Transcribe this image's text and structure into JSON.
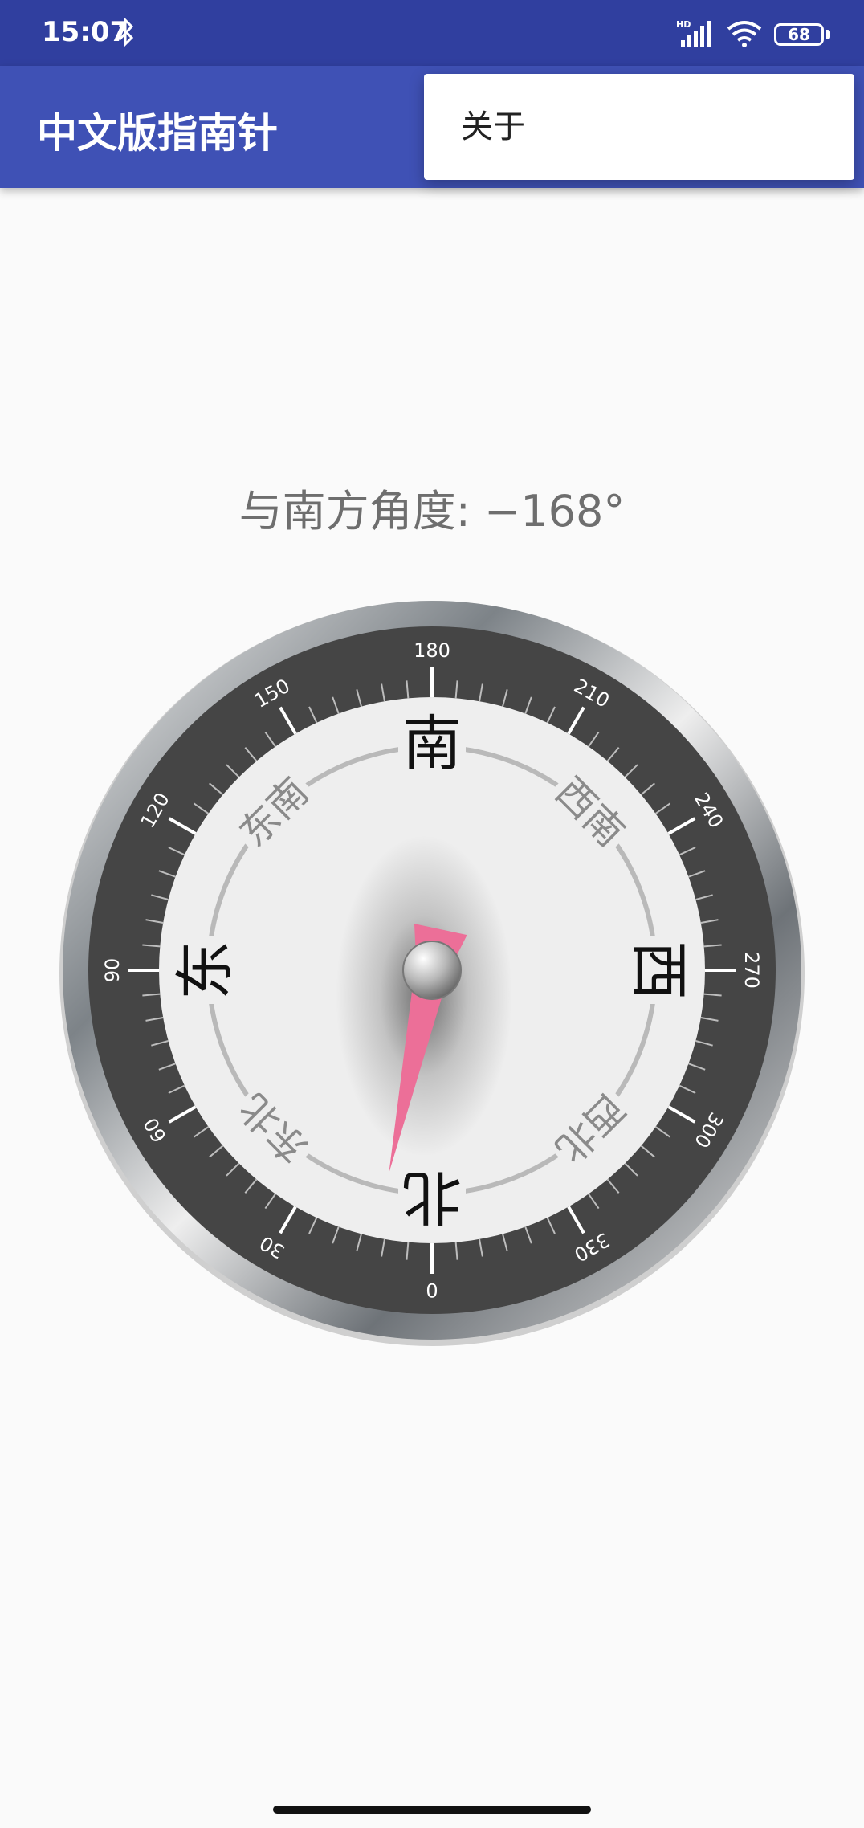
{
  "status_bar": {
    "time": "15:07",
    "battery": "68",
    "network_badge": "HD",
    "icons": [
      "bluetooth-icon",
      "signal-icon",
      "wifi-icon",
      "battery-icon"
    ]
  },
  "app_bar": {
    "title": "中文版指南针"
  },
  "menu": {
    "items": [
      {
        "label": "关于"
      }
    ]
  },
  "compass": {
    "angle_text": "与南方角度: −168°",
    "heading_degrees": -168,
    "cardinals": {
      "south": "南",
      "north": "北",
      "east": "东",
      "west": "西"
    },
    "intercardinals": {
      "southeast": "东南",
      "southwest": "西南",
      "northeast": "东北",
      "northwest": "西北"
    },
    "degree_labels": [
      "0",
      "30",
      "60",
      "90",
      "120",
      "150",
      "180",
      "210",
      "240",
      "270",
      "300",
      "330"
    ],
    "colors": {
      "bezel": "#9aa0a4",
      "ring": "#454545",
      "face": "#eeeeee",
      "needle": "#ec6f98"
    }
  }
}
